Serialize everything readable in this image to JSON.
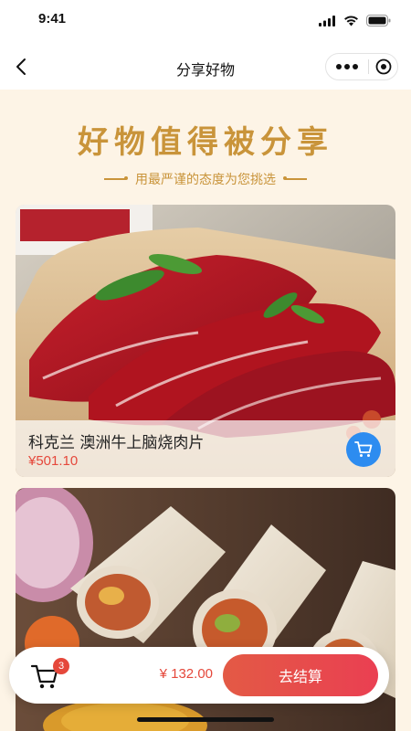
{
  "status_bar": {
    "time": "9:41",
    "icons": [
      "signal-icon",
      "wifi-icon",
      "battery-icon"
    ]
  },
  "nav": {
    "title": "分享好物",
    "back_icon": "chevron-left-icon",
    "capsule_icons": [
      "more-dots-icon",
      "close-target-icon"
    ]
  },
  "hero": {
    "title": "好物值得被分享",
    "subtitle": "用最严谨的态度为您挑选"
  },
  "products": [
    {
      "name": "科克兰 澳洲牛上脑烧肉片",
      "price": "¥501.10",
      "image": "raw-beef-slices",
      "cart_icon": "cart-icon"
    },
    {
      "name": "",
      "price": "",
      "image": "chicken-wraps"
    }
  ],
  "cart_bar": {
    "count": "3",
    "total": "¥ 132.00",
    "checkout_label": "去结算"
  },
  "colors": {
    "accent_gold": "#c9943a",
    "price_red": "#e5483b",
    "cart_blue": "#2d8cf0",
    "background": "#fdf4e6",
    "checkout_gradient_start": "#e35a45",
    "checkout_gradient_end": "#ea3f52"
  }
}
